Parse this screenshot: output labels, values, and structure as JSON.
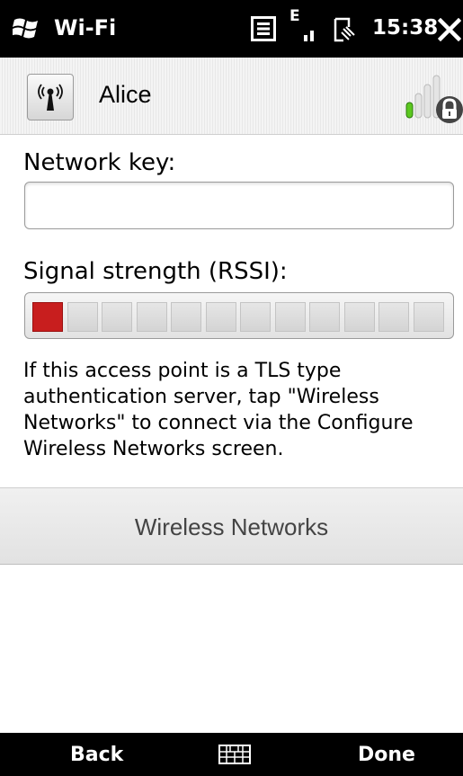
{
  "status_bar": {
    "app_title": "Wi-Fi",
    "network_type": "E",
    "time": "15:38",
    "icons": [
      "windows-logo-icon",
      "notification-icon",
      "network-signal-icon",
      "battery-icon",
      "close-icon"
    ]
  },
  "header": {
    "network_name": "Alice",
    "icons": [
      "access-point-icon",
      "signal-strength-lock-icon"
    ]
  },
  "network_key": {
    "label": "Network key:",
    "value": ""
  },
  "signal": {
    "label": "Signal strength (RSSI):",
    "total_segments": 12,
    "active_segments": 1,
    "active_color": "#c81e1e"
  },
  "info_text": "If this access point is a TLS type authentication server, tap \"Wireless Networks\" to connect via the Configure Wireless Networks screen.",
  "wireless_networks_button": "Wireless Networks",
  "softkeys": {
    "left": "Back",
    "right": "Done",
    "center_icon": "keyboard-icon"
  }
}
